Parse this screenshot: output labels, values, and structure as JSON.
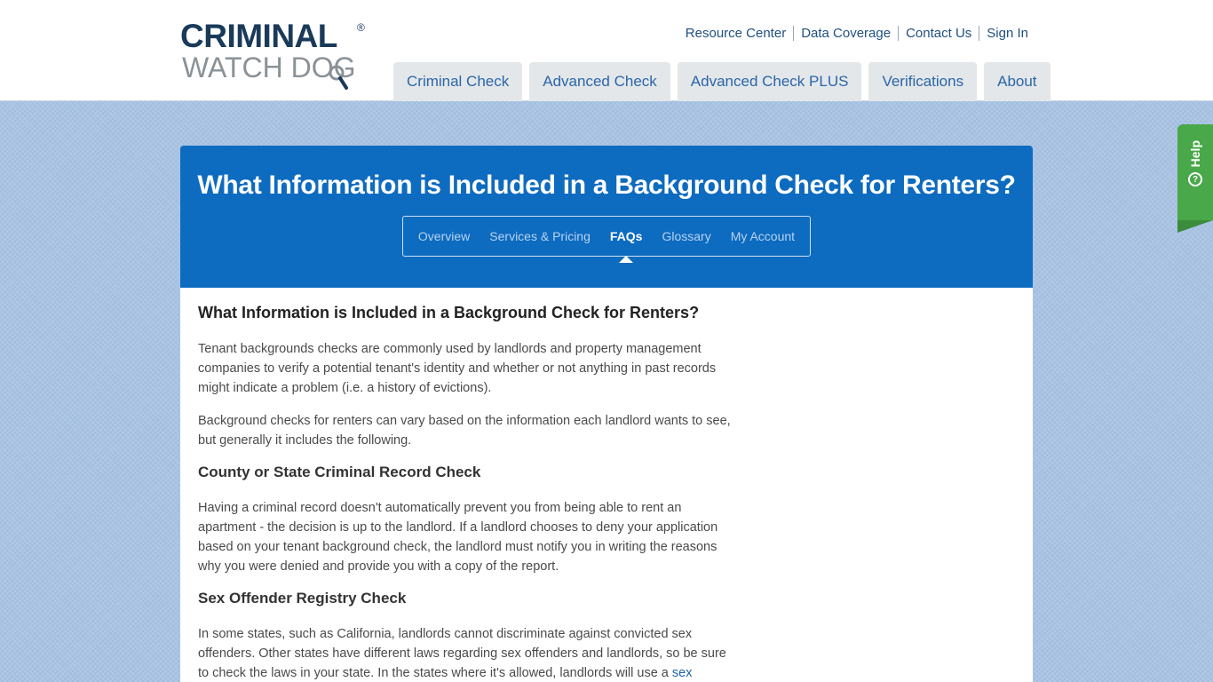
{
  "logo": {
    "line1": "CRIMINAL",
    "registered": "®",
    "line2": "WATCH DOG"
  },
  "top_links": [
    "Resource Center",
    "Data Coverage",
    "Contact Us",
    "Sign In"
  ],
  "main_nav": [
    "Criminal Check",
    "Advanced Check",
    "Advanced Check PLUS",
    "Verifications",
    "About"
  ],
  "help_tab": {
    "label": "Help",
    "icon": "question-circle-icon"
  },
  "banner": {
    "title": "What Information is Included in a Background Check for Renters?",
    "subnav": [
      {
        "label": "Overview",
        "active": false
      },
      {
        "label": "Services & Pricing",
        "active": false
      },
      {
        "label": "FAQs",
        "active": true
      },
      {
        "label": "Glossary",
        "active": false
      },
      {
        "label": "My Account",
        "active": false
      }
    ]
  },
  "article": {
    "heading": "What Information is Included in a Background Check for Renters?",
    "p1": "Tenant backgrounds checks are commonly used by landlords and property management companies to verify a potential tenant's identity and whether or not anything in past records might indicate a problem (i.e. a history of evictions).",
    "p2": "Background checks for renters can vary based on the information each landlord wants to see, but generally it includes the following.",
    "h_criminal": "County or State Criminal Record Check",
    "p3": "Having a criminal record doesn't automatically prevent you from being able to rent an apartment - the decision is up to the landlord. If a landlord chooses to deny your application based on your tenant background check, the landlord must notify you in writing the reasons why you were denied and provide you with a copy of the report.",
    "h_sex": "Sex Offender Registry Check",
    "p4_start": "In some states, such as California, landlords cannot discriminate against convicted sex offenders. Other states have different laws regarding sex offenders and landlords, so be sure to check the laws in your state. In the states where it's allowed, landlords will use a ",
    "p4_link": "sex offender"
  },
  "colors": {
    "banner": "#0d6bc0",
    "help": "#49a84a",
    "link": "#1f4f82",
    "nav_tab_bg": "#e4e7ea"
  }
}
